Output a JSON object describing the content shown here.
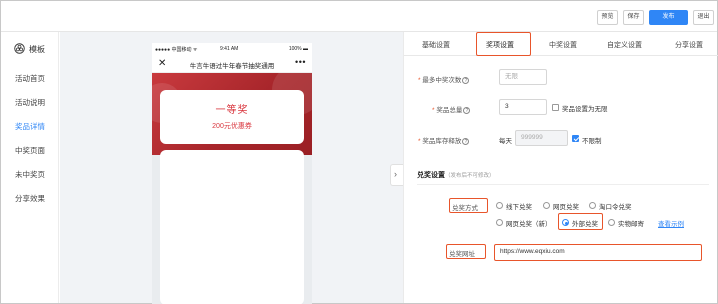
{
  "topbar": {
    "preview": "预览",
    "save": "保存",
    "publish": "发布",
    "exit": "退出"
  },
  "sidebar": {
    "header": "模板",
    "items": [
      {
        "label": "活动首页"
      },
      {
        "label": "活动说明"
      },
      {
        "label": "奖品详情"
      },
      {
        "label": "中奖页面"
      },
      {
        "label": "未中奖页"
      },
      {
        "label": "分享效果"
      }
    ]
  },
  "phone": {
    "carrier": "●●●●● 中国移动 ᯤ",
    "time": "9:41 AM",
    "battery": "100% ▬",
    "title": "牛言牛语过牛年春节抽奖通用",
    "close": "✕",
    "more": "•••",
    "prize_title": "一等奖",
    "prize_sub": "200元优惠券"
  },
  "tabs": [
    "基础设置",
    "奖项设置",
    "中奖设置",
    "自定义设置",
    "分享设置"
  ],
  "form": {
    "max_wins_label": "最多中奖次数",
    "max_wins_placeholder": "无限",
    "total_prizes_label": "奖品总量",
    "total_prizes_value": "3",
    "unlimited_prizes_label": "奖品设置为无限",
    "stock_label": "奖品库存释放",
    "daily_label": "每天",
    "daily_placeholder": "999999",
    "unlimited_label": "不限制"
  },
  "redeem": {
    "section_title": "兑奖设置",
    "section_note": "（发布后不可修改）",
    "method_label": "兑奖方式",
    "options": [
      "线下兑奖",
      "网页兑奖",
      "淘口令兑奖",
      "网页兑奖（新）",
      "外部兑奖",
      "实物邮寄"
    ],
    "view_example": "查看示例",
    "url_label": "兑奖网址",
    "url_value": "https://www.eqxiu.com"
  }
}
